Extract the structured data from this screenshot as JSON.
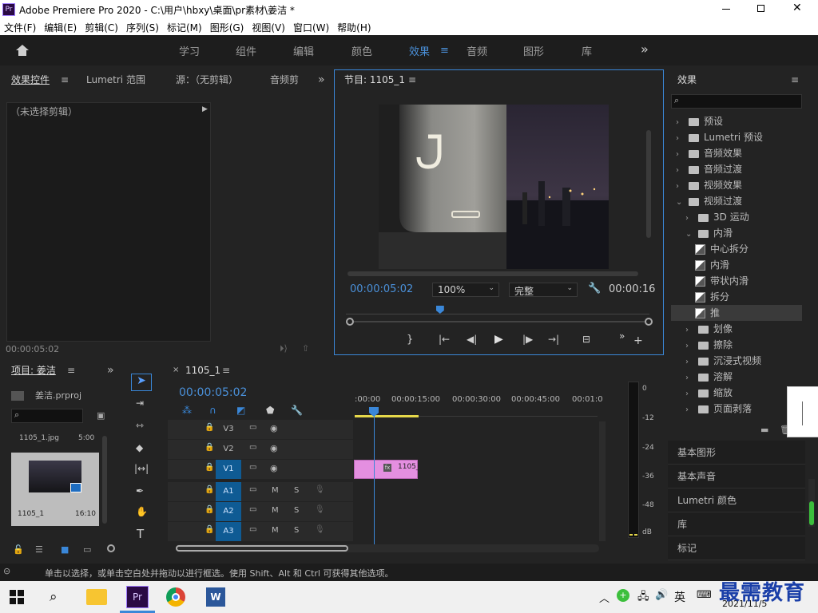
{
  "window": {
    "app_badge": "Pr",
    "title": "Adobe Premiere Pro 2020 - C:\\用户\\hbxy\\桌面\\pr素材\\姜洁 *",
    "min_icon": "minimize-icon",
    "max_icon": "maximize-icon",
    "close_icon": "close-icon"
  },
  "menu": [
    "文件(F)",
    "编辑(E)",
    "剪辑(C)",
    "序列(S)",
    "标记(M)",
    "图形(G)",
    "视图(V)",
    "窗口(W)",
    "帮助(H)"
  ],
  "workspaces": {
    "items": [
      "学习",
      "组件",
      "编辑",
      "颜色",
      "效果",
      "音频",
      "图形",
      "库"
    ],
    "active": "效果",
    "more": "»"
  },
  "source_panel": {
    "tabs": [
      "效果控件",
      "Lumetri 范围",
      "源：（无剪辑）",
      "音频剪"
    ],
    "no_clip": "（未选择剪辑）",
    "timecode": "00:00:05:02"
  },
  "program": {
    "title": "节目: 1105_1",
    "timecode": "00:00:05:02",
    "zoom": "100%",
    "quality": "完整",
    "duration": "00:00:16",
    "playhead_fraction": 0.31
  },
  "project": {
    "title": "项目: 姜洁",
    "file": "姜洁.prproj",
    "clip_name": "1105_1.jpg",
    "clip_dur": "5:00",
    "seq_name": "1105_1",
    "seq_dur": "16:10"
  },
  "timeline": {
    "tab": "1105_1",
    "timecode": "00:00:05:02",
    "ruler": [
      ":00:00",
      "00:00:15:00",
      "00:00:30:00",
      "00:00:45:00",
      "00:01:0"
    ],
    "video_tracks": [
      "V3",
      "V2",
      "V1"
    ],
    "audio_tracks": [
      "A1",
      "A2",
      "A3"
    ],
    "mute": "M",
    "solo": "S",
    "clip_label": "1105_",
    "meter_scale": [
      "0",
      "-12",
      "-24",
      "-36",
      "-48",
      "dB"
    ]
  },
  "effects": {
    "title": "效果",
    "tree": [
      {
        "label": "预设",
        "level": 0,
        "kind": "preset"
      },
      {
        "label": "Lumetri 预设",
        "level": 0,
        "kind": "preset"
      },
      {
        "label": "音频效果",
        "level": 0,
        "kind": "folder"
      },
      {
        "label": "音频过渡",
        "level": 0,
        "kind": "folder"
      },
      {
        "label": "视频效果",
        "level": 0,
        "kind": "folder"
      },
      {
        "label": "视频过渡",
        "level": 0,
        "kind": "folder-open"
      },
      {
        "label": "3D 运动",
        "level": 1,
        "kind": "folder"
      },
      {
        "label": "内滑",
        "level": 1,
        "kind": "folder-open"
      },
      {
        "label": "中心拆分",
        "level": 2,
        "kind": "fx"
      },
      {
        "label": "内滑",
        "level": 2,
        "kind": "fx"
      },
      {
        "label": "带状内滑",
        "level": 2,
        "kind": "fx"
      },
      {
        "label": "拆分",
        "level": 2,
        "kind": "fx"
      },
      {
        "label": "推",
        "level": 2,
        "kind": "fx",
        "selected": true
      },
      {
        "label": "划像",
        "level": 1,
        "kind": "folder"
      },
      {
        "label": "擦除",
        "level": 1,
        "kind": "folder"
      },
      {
        "label": "沉浸式视频",
        "level": 1,
        "kind": "folder"
      },
      {
        "label": "溶解",
        "level": 1,
        "kind": "folder"
      },
      {
        "label": "缩放",
        "level": 1,
        "kind": "folder"
      },
      {
        "label": "页面剥落",
        "level": 1,
        "kind": "folder"
      }
    ]
  },
  "side_panels": [
    "基本图形",
    "基本声音",
    "Lumetri 颜色",
    "库",
    "标记"
  ],
  "status": "单击以选择，或单击空白处并拖动以进行框选。使用 Shift、Alt 和 Ctrl 可获得其他选项。",
  "taskbar": {
    "ime": "英",
    "date": "2021/11/5",
    "watermark": "最需教育"
  }
}
